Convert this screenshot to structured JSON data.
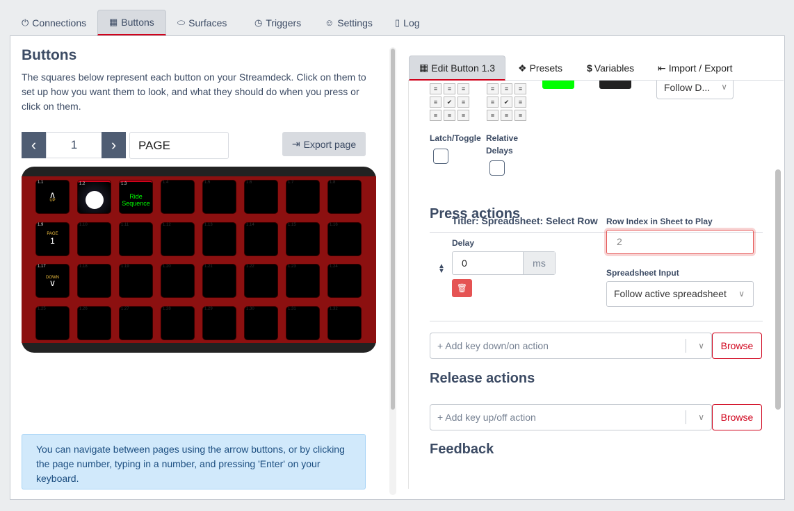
{
  "topnav": {
    "tabs": [
      {
        "label": "Connections",
        "icon": "plug-icon"
      },
      {
        "label": "Buttons",
        "icon": "calculator-icon"
      },
      {
        "label": "Surfaces",
        "icon": "gamepad-icon"
      },
      {
        "label": "Triggers",
        "icon": "clock-icon"
      },
      {
        "label": "Settings",
        "icon": "user-cog-icon"
      },
      {
        "label": "Log",
        "icon": "file-icon"
      }
    ],
    "active": "Buttons"
  },
  "buttons_panel": {
    "title": "Buttons",
    "description": "The squares below represent each button on your Streamdeck. Click on them to set up how you want them to look, and what they should do when you press or click on them.",
    "page_number": "1",
    "page_name": "PAGE",
    "export_label": "Export page",
    "info_text": "You can navigate between pages using the arrow buttons, or by clicking the page number, typing in a number, and pressing 'Enter' on your keyboard."
  },
  "deck": {
    "keys": [
      {
        "id": "1.1",
        "label": "UP",
        "type": "up"
      },
      {
        "id": "1.2",
        "label": "",
        "type": "circle"
      },
      {
        "id": "1.3",
        "label": "Ride Sequence",
        "type": "text"
      },
      {
        "id": "1.4"
      },
      {
        "id": "1.5"
      },
      {
        "id": "1.6"
      },
      {
        "id": "1.7"
      },
      {
        "id": "1.8"
      },
      {
        "id": "1.9",
        "label": "PAGE",
        "value": "1",
        "type": "page"
      },
      {
        "id": "1.10"
      },
      {
        "id": "1.11"
      },
      {
        "id": "1.12"
      },
      {
        "id": "1.13"
      },
      {
        "id": "1.14"
      },
      {
        "id": "1.15"
      },
      {
        "id": "1.16"
      },
      {
        "id": "1.17",
        "label": "DOWN",
        "type": "down"
      },
      {
        "id": "1.18"
      },
      {
        "id": "1.19"
      },
      {
        "id": "1.20"
      },
      {
        "id": "1.21"
      },
      {
        "id": "1.22"
      },
      {
        "id": "1.23"
      },
      {
        "id": "1.24"
      },
      {
        "id": "1.25"
      },
      {
        "id": "1.26"
      },
      {
        "id": "1.27"
      },
      {
        "id": "1.28"
      },
      {
        "id": "1.29"
      },
      {
        "id": "1.30"
      },
      {
        "id": "1.31"
      },
      {
        "id": "1.32"
      }
    ]
  },
  "editor": {
    "tabs": [
      {
        "label": "Edit Button 1.3",
        "icon": "calculator-icon"
      },
      {
        "label": "Presets",
        "icon": "gift-icon"
      },
      {
        "label": "Variables",
        "icon": "dollar-icon"
      },
      {
        "label": "Import / Export",
        "icon": "file-import-icon"
      }
    ],
    "follow_select": "Follow D...",
    "text_color": "#00ff00",
    "bg_color": "#222222",
    "latch_label": "Latch/Toggle",
    "relative_delays_label": "Relative Delays",
    "press_actions_title": "Press actions",
    "action": {
      "title": "Titler: Spreadsheet: Select Row",
      "delay_label": "Delay",
      "delay_value": "0",
      "delay_unit": "ms",
      "row_index_label": "Row Index in Sheet to Play",
      "row_index_value": "2",
      "spreadsheet_input_label": "Spreadsheet Input",
      "spreadsheet_input_value": "Follow active spreadsheet"
    },
    "add_down_placeholder": "+ Add key down/on action",
    "browse_label": "Browse",
    "release_actions_title": "Release actions",
    "add_up_placeholder": "+ Add key up/off action",
    "feedback_title": "Feedback"
  }
}
